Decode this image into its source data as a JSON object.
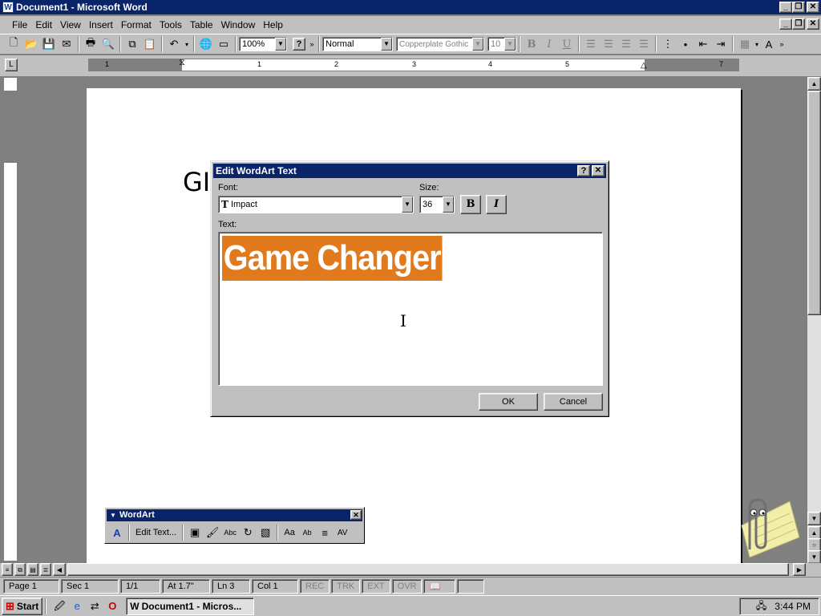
{
  "window": {
    "title": "Document1 - Microsoft Word"
  },
  "menu": [
    {
      "label": "File"
    },
    {
      "label": "Edit"
    },
    {
      "label": "View"
    },
    {
      "label": "Insert"
    },
    {
      "label": "Format"
    },
    {
      "label": "Tools"
    },
    {
      "label": "Table"
    },
    {
      "label": "Window"
    },
    {
      "label": "Help"
    }
  ],
  "toolbar": {
    "zoom": "100%",
    "help_glyph": "?",
    "style": "Normal",
    "font": "Copperplate Gothic",
    "font_size": "10",
    "bold": "B",
    "italic": "I",
    "underline": "U"
  },
  "ruler": {
    "numbers": [
      "1",
      "1",
      "2",
      "3",
      "4",
      "5",
      "6",
      "7"
    ]
  },
  "document": {
    "visible_text": "GI"
  },
  "dialog": {
    "title": "Edit WordArt Text",
    "font_label": "Font:",
    "font_value": "Impact",
    "size_label": "Size:",
    "size_value": "36",
    "bold_label": "B",
    "italic_label": "I",
    "text_label": "Text:",
    "text_value": "Game Changer",
    "ok_label": "OK",
    "cancel_label": "Cancel",
    "help_glyph": "?",
    "close_glyph": "✕",
    "highlight_color": "#e07a1c"
  },
  "wordart_toolbar": {
    "title": "WordArt",
    "edit_text_label": "Edit Text...",
    "close_glyph": "✕"
  },
  "statusbar": {
    "page": "Page  1",
    "sec": "Sec  1",
    "pages": "1/1",
    "at": "At  1.7\"",
    "ln": "Ln  3",
    "col": "Col  1",
    "rec": "REC",
    "trk": "TRK",
    "ext": "EXT",
    "ovr": "OVR"
  },
  "taskbar": {
    "start_label": "Start",
    "task_label": "Document1 - Micros...",
    "clock": "3:44 PM"
  }
}
